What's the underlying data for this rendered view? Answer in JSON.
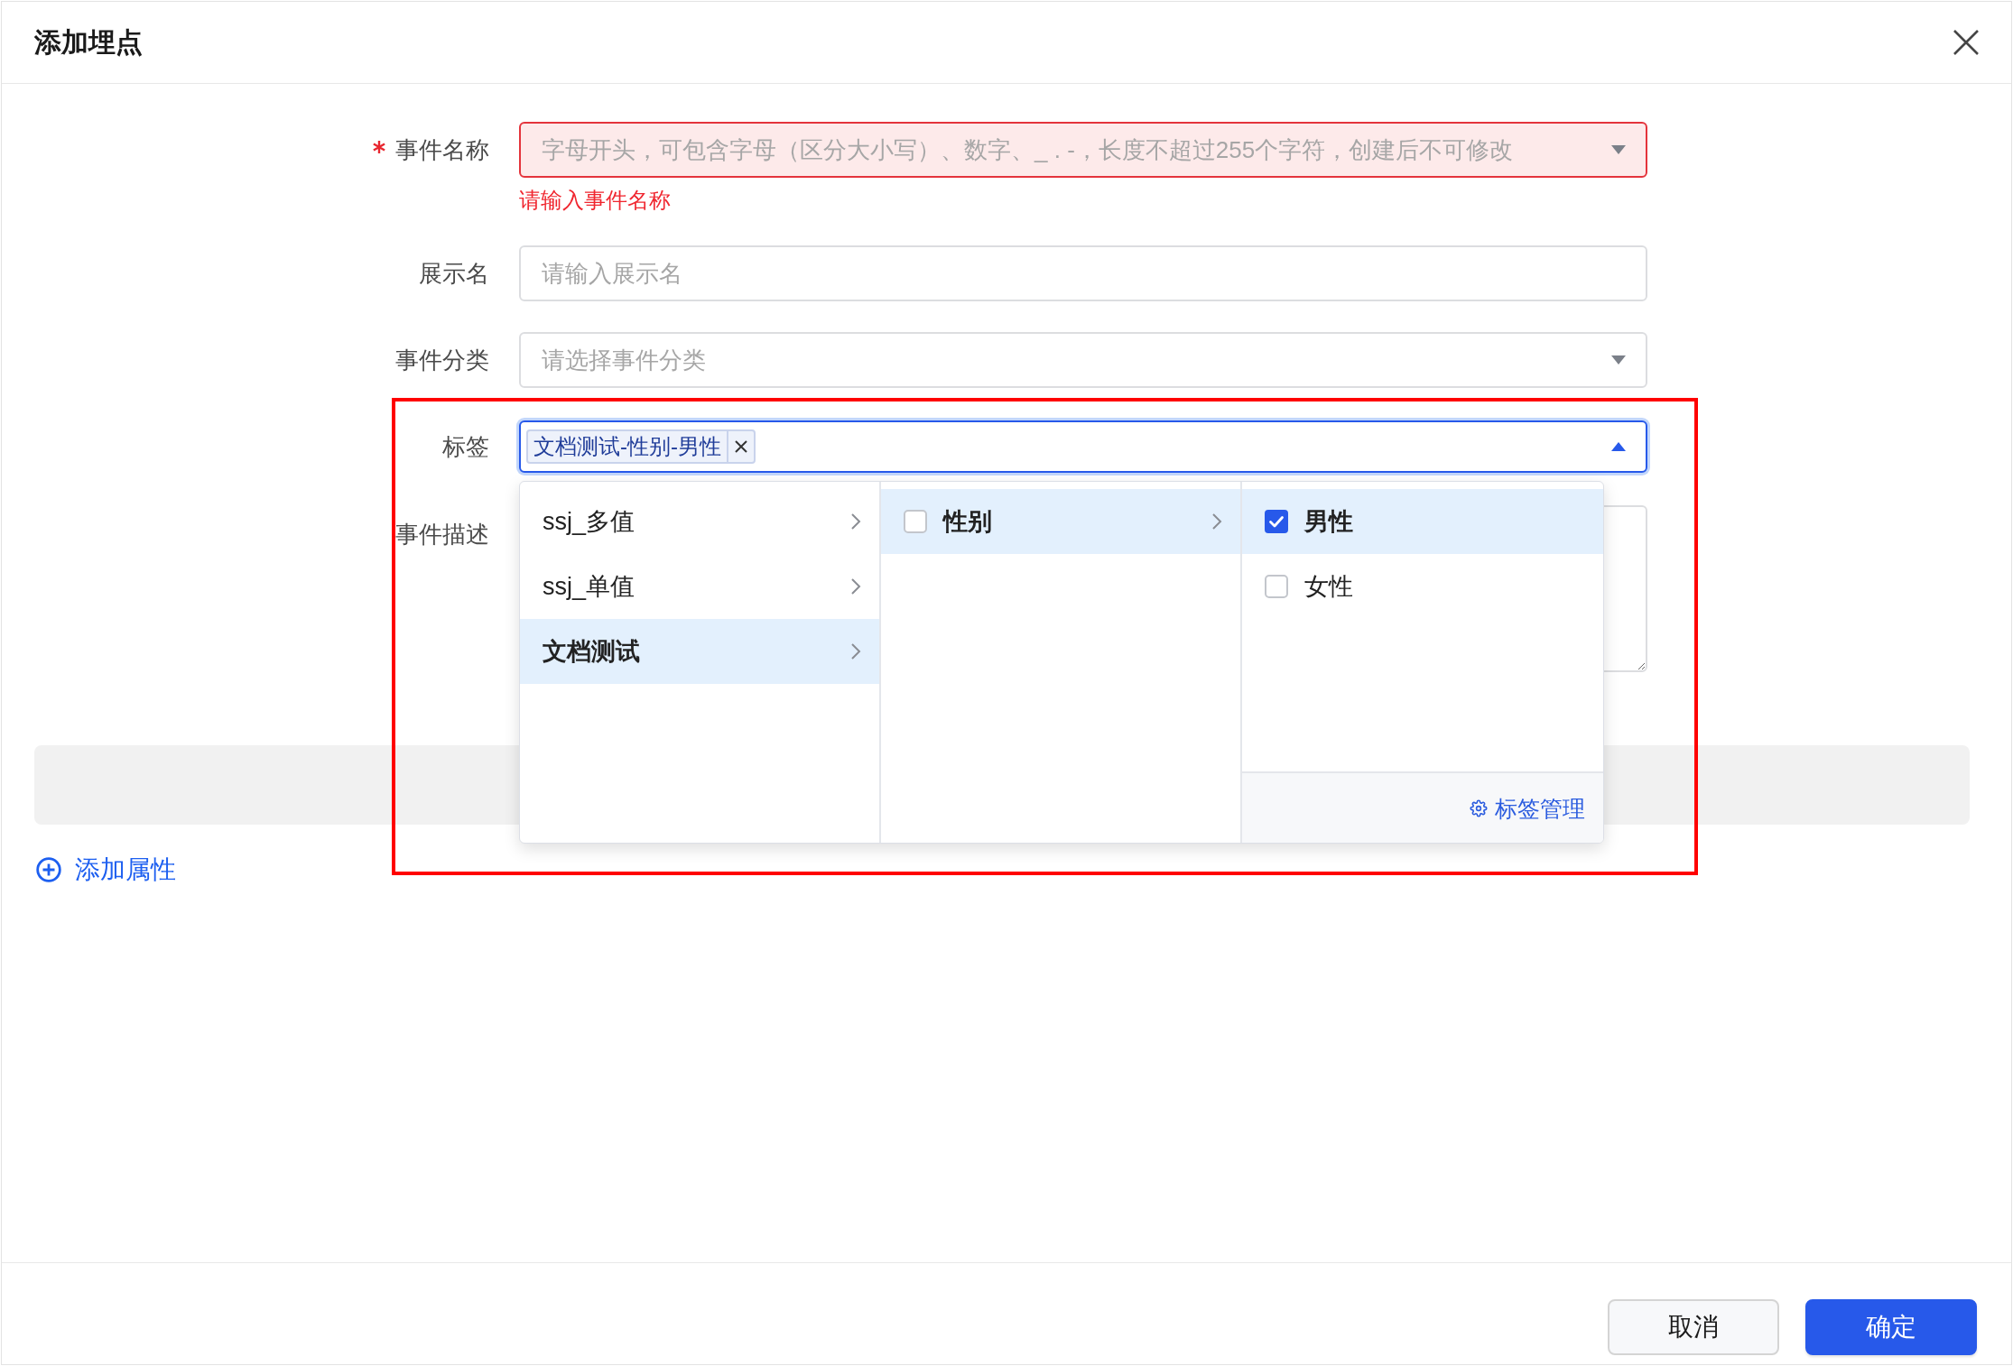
{
  "dialog": {
    "title": "添加埋点"
  },
  "form": {
    "fields": [
      {
        "kind": "select",
        "label": "事件名称",
        "required": true,
        "placeholder": "字母开头，可包含字母（区分大小写）、数字、_ . -，长度不超过255个字符，创建后不可修改",
        "expanded": false,
        "focused": false,
        "error": "请输入事件名称"
      },
      {
        "kind": "input",
        "label": "展示名",
        "required": false,
        "placeholder": "请输入展示名",
        "focused": false
      },
      {
        "kind": "select",
        "label": "事件分类",
        "required": false,
        "placeholder": "请选择事件分类",
        "expanded": false,
        "focused": false
      },
      {
        "kind": "tags",
        "label": "标签",
        "required": false,
        "focused": true,
        "expanded": true,
        "tags": [
          {
            "label": "文档测试-性别-男性"
          }
        ],
        "menu": {
          "columns": [
            {
              "kind": "plain",
              "items": [
                {
                  "label": "ssj_多值",
                  "selected": false,
                  "has_children": true
                },
                {
                  "label": "ssj_单值",
                  "selected": false,
                  "has_children": true
                },
                {
                  "label": "文档测试",
                  "selected": true,
                  "has_children": true
                }
              ]
            },
            {
              "kind": "checkbox",
              "items": [
                {
                  "label": "性别",
                  "selected": true,
                  "checked": false,
                  "has_children": true
                }
              ]
            },
            {
              "kind": "checkbox",
              "items": [
                {
                  "label": "男性",
                  "selected": true,
                  "checked": true,
                  "has_children": false
                },
                {
                  "label": "女性",
                  "selected": false,
                  "checked": false,
                  "has_children": false
                }
              ],
              "footer": {
                "label": "标签管理"
              }
            }
          ]
        }
      },
      {
        "kind": "textarea",
        "label": "事件描述",
        "required": false,
        "focused": false
      }
    ]
  },
  "add_attribute": {
    "label": "添加属性"
  },
  "buttons": [
    {
      "kind": "secondary",
      "label": "取消"
    },
    {
      "kind": "primary",
      "label": "确定"
    }
  ]
}
